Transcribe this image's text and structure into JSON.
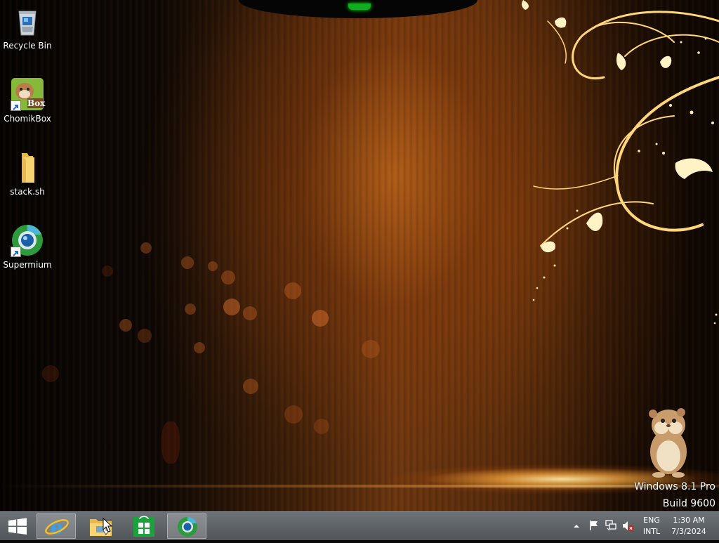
{
  "desktop": {
    "icons": [
      {
        "label": "Recycle Bin",
        "icon": "recycle-bin-icon"
      },
      {
        "label": "ChomikBox",
        "icon": "chomikbox-icon",
        "badge": "Box"
      },
      {
        "label": "stack.sh",
        "icon": "folder-icon"
      },
      {
        "label": "Supermium",
        "icon": "supermium-icon"
      }
    ],
    "watermark": {
      "line1": "Windows 8.1 Pro",
      "line2": "Build 9600"
    }
  },
  "taskbar": {
    "start": {
      "icon": "windows-logo-icon"
    },
    "pinned": [
      {
        "name": "internet-explorer",
        "icon": "internet-explorer-icon",
        "active": true
      },
      {
        "name": "file-explorer",
        "icon": "file-explorer-icon",
        "active": false
      },
      {
        "name": "store",
        "icon": "store-icon",
        "active": false
      },
      {
        "name": "supermium",
        "icon": "supermium-icon",
        "active": true
      }
    ],
    "tray": {
      "icons": [
        "chevron-up-icon",
        "flag-icon",
        "network-icon",
        "volume-muted-icon"
      ],
      "language": {
        "line1": "ENG",
        "line2": "INTL"
      },
      "clock": {
        "time": "1:30 AM",
        "date": "7/3/2024"
      }
    }
  },
  "colors": {
    "taskbar": "#5b6065",
    "accent_gold": "#ffcf6a",
    "store_green": "#1aa33a"
  }
}
